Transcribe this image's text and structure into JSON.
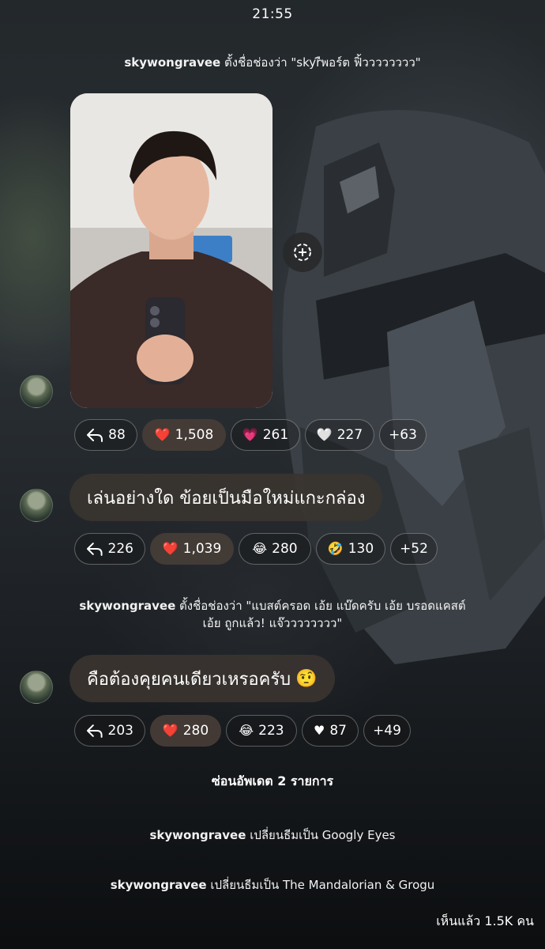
{
  "status_bar": {
    "time": "21:55"
  },
  "system_messages": [
    {
      "user": "skywongravee",
      "text": "ตั้งชื่อช่องว่า \"skyrืพอร์ต ฟิ้วววววววว\""
    },
    {
      "user": "skywongravee",
      "text": "ตั้งชื่อช่องว่า \"แบสต์ครอด เอ้ย แบ๊ดครับ เอ้ย บรอดแคสต์",
      "text_line2": "เอ้ย ถูกแล้ว! แจ๊วววววววว\""
    },
    {
      "user": "skywongravee",
      "text": "เปลี่ยนธีมเป็น Googly Eyes"
    },
    {
      "user": "skywongravee",
      "text": "เปลี่ยนธีมเป็น The Mandalorian & Grogu"
    }
  ],
  "photo_message": {
    "reactions": [
      {
        "icon": "reply-icon",
        "count": "88"
      },
      {
        "icon": "red-heart-emoji",
        "emoji": "❤️",
        "count": "1,508",
        "active": true
      },
      {
        "icon": "sparkling-heart-emoji",
        "emoji": "💗",
        "count": "261"
      },
      {
        "icon": "white-heart-emoji",
        "emoji": "🤍",
        "count": "227"
      },
      {
        "icon": "more-reactions",
        "count": "+63"
      }
    ]
  },
  "messages": [
    {
      "text": "เล่นอย่างใด ข้อยเป็นมือใหม่แกะกล่อง",
      "reactions": [
        {
          "icon": "reply-icon",
          "count": "226"
        },
        {
          "icon": "red-heart-emoji",
          "emoji": "❤️",
          "count": "1,039",
          "active": true
        },
        {
          "icon": "joy-emoji",
          "emoji": "😂",
          "count": "280"
        },
        {
          "icon": "rofl-emoji",
          "emoji": "🤣",
          "count": "130"
        },
        {
          "icon": "more-reactions",
          "count": "+52"
        }
      ]
    },
    {
      "text": "คือต้องคุยคนเดียวเหรอครับ",
      "emoji": "🤨",
      "reactions": [
        {
          "icon": "reply-icon",
          "count": "203"
        },
        {
          "icon": "red-heart-emoji",
          "emoji": "❤️",
          "count": "280",
          "active": true
        },
        {
          "icon": "joy-emoji",
          "emoji": "😂",
          "count": "223"
        },
        {
          "icon": "white-heart-emoji",
          "emoji": "♥",
          "count": "87"
        },
        {
          "icon": "more-reactions",
          "count": "+49"
        }
      ]
    }
  ],
  "hidden_updates": "ซ่อนอัพเดต 2 รายการ",
  "seen_by": "เห็นแล้ว 1.5K คน",
  "colors": {
    "bubble": "#3a3430",
    "active_pill": "#463c37"
  }
}
